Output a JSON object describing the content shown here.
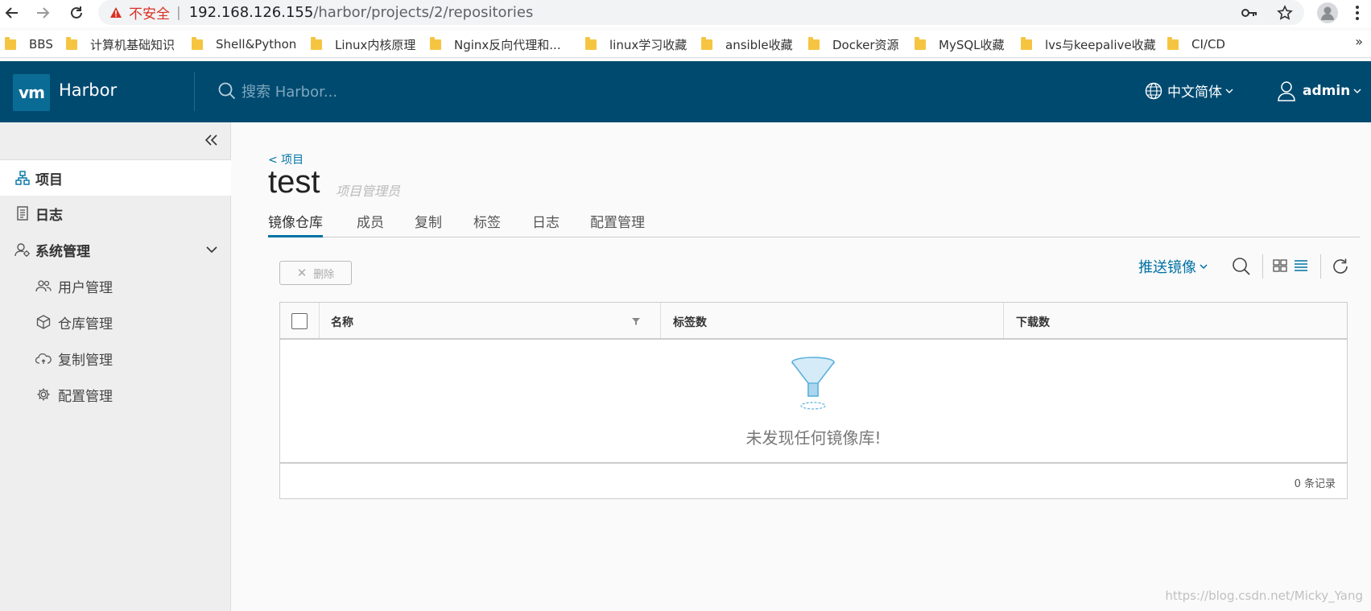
{
  "browser": {
    "insecure_label": "不安全",
    "separator": "|",
    "url_host": "192.168.126.155",
    "url_path": "/harbor/projects/2/repositories",
    "bookmarks": [
      "BBS",
      "计算机基础知识",
      "Shell&Python",
      "Linux内核原理",
      "Nginx反向代理和...",
      "linux学习收藏",
      "ansible收藏",
      "Docker资源",
      "MySQL收藏",
      "lvs与keepalive收藏",
      "CI/CD"
    ],
    "more": "»"
  },
  "header": {
    "logo_text": "vm",
    "brand": "Harbor",
    "search_placeholder": "搜索 Harbor...",
    "language": "中文简体",
    "user": "admin",
    "bg_color": "#004a70"
  },
  "sidebar": {
    "items": [
      {
        "label": "项目",
        "icon": "project-icon",
        "active": true
      },
      {
        "label": "日志",
        "icon": "log-icon"
      },
      {
        "label": "系统管理",
        "icon": "admin-icon",
        "expanded": true
      }
    ],
    "sub_items": [
      {
        "label": "用户管理",
        "icon": "users-icon"
      },
      {
        "label": "仓库管理",
        "icon": "box-icon"
      },
      {
        "label": "复制管理",
        "icon": "cloud-sync-icon"
      },
      {
        "label": "配置管理",
        "icon": "gear-icon"
      }
    ]
  },
  "main": {
    "back_link": "< 项目",
    "project_name": "test",
    "project_role": "项目管理员",
    "tabs": [
      "镜像仓库",
      "成员",
      "复制",
      "标签",
      "日志",
      "配置管理"
    ],
    "active_tab": "镜像仓库",
    "delete_label": "删除",
    "push_label": "推送镜像",
    "columns": [
      "名称",
      "标签数",
      "下载数"
    ],
    "empty_text": "未发现任何镜像库!",
    "footer_count": "0 条记录"
  },
  "watermark": "https://blog.csdn.net/Micky_Yang",
  "colors": {
    "accent": "#0072a3",
    "warning": "#d93025"
  }
}
